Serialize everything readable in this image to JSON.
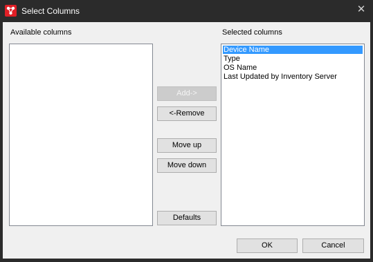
{
  "window": {
    "title": "Select Columns",
    "close_glyph": "✕"
  },
  "available": {
    "label": "Available columns",
    "items": []
  },
  "selected": {
    "label": "Selected columns",
    "items": [
      {
        "label": "Device Name",
        "selected": true
      },
      {
        "label": "Type",
        "selected": false
      },
      {
        "label": "OS Name",
        "selected": false
      },
      {
        "label": "Last Updated by Inventory Server",
        "selected": false
      }
    ]
  },
  "buttons": {
    "add": "Add->",
    "remove": "<-Remove",
    "move_up": "Move up",
    "move_down": "Move down",
    "defaults": "Defaults",
    "ok": "OK",
    "cancel": "Cancel"
  },
  "colors": {
    "titlebar": "#2b2b2b",
    "dialog_bg": "#f0f0f0",
    "selection": "#3399ff",
    "app_icon": "#e11f26"
  }
}
